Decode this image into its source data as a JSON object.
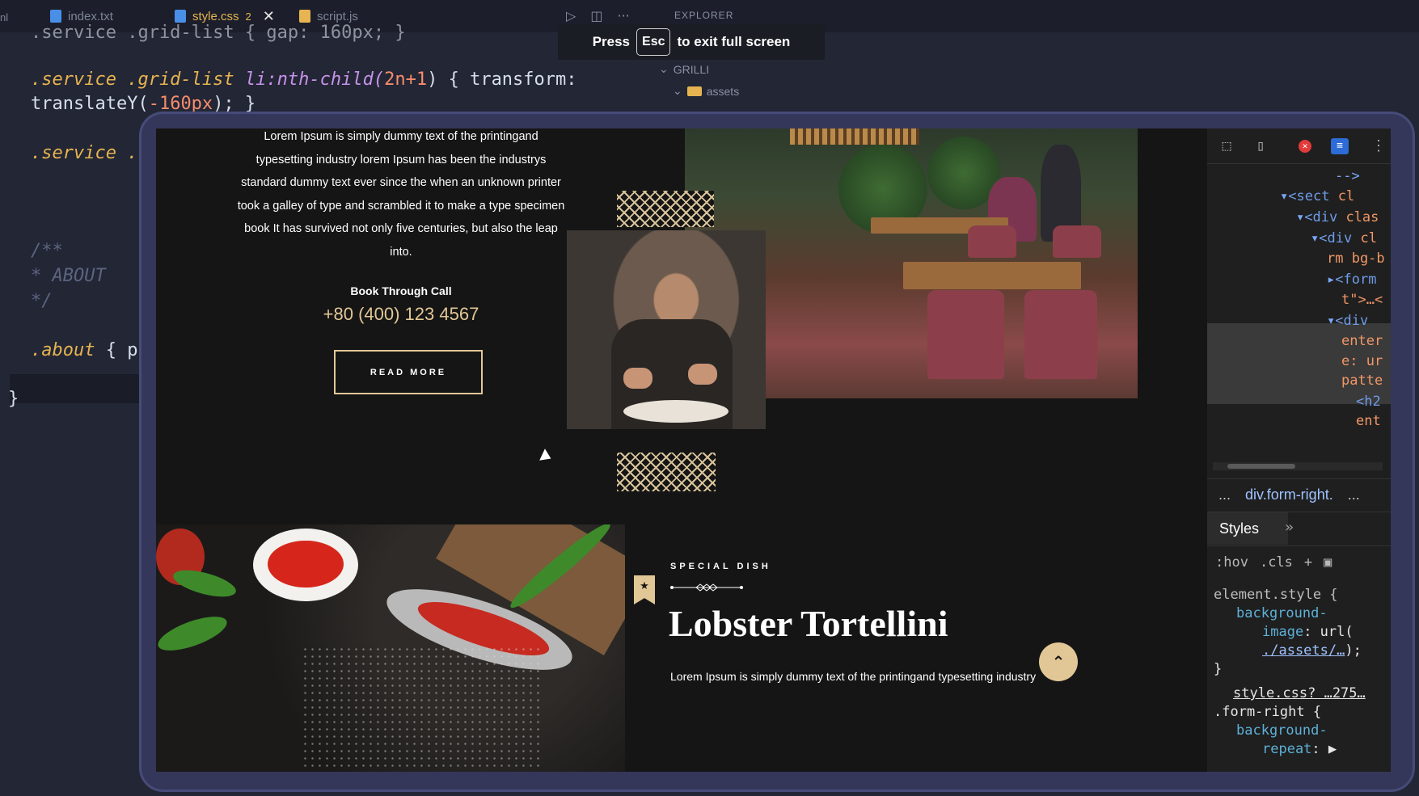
{
  "editor": {
    "edge_label": "nl",
    "tabs": [
      {
        "label": "index.txt",
        "icon": "file-text-icon",
        "icon_color": "#4a8fe7"
      },
      {
        "label": "style.css",
        "badge": "2",
        "close": "✕",
        "icon": "css-file-icon",
        "icon_color": "#4a8fe7"
      },
      {
        "label": "script.js",
        "icon": "js-file-icon",
        "icon_color": "#e6b450"
      }
    ],
    "actions": [
      "▷",
      "◫",
      "···"
    ],
    "explorer": {
      "title": "EXPLORER",
      "project": "GRILLI",
      "folder": "assets"
    },
    "code_lines": {
      "l0": ".service .grid-list { gap: 160px; }",
      "l1_sel": ".service .grid-list",
      "l1_pseudo": " li:nth-child(",
      "l1_num": "2n+1",
      "l1_rest": ") { transform:",
      "l2_fn": "translateY(",
      "l2_num": "-160px",
      "l2_rest": "); }",
      "l3": ".service .",
      "l4": "/**",
      "l5": " * ABOUT",
      "l6": " */",
      "l7_sel": ".about",
      "l7_rest": " { p",
      "l8": "}"
    }
  },
  "fullscreen_banner": {
    "press": "Press",
    "key": "Esc",
    "text": "to exit full screen"
  },
  "page": {
    "intro_text": "Lorem Ipsum is simply dummy text of the printingand typesetting industry lorem Ipsum has been the industrys standard dummy text ever since the when an unknown printer took a galley of type and scrambled it to make a type specimen book It has survived not only five centuries, but also the leap into.",
    "book_label": "Book Through Call",
    "phone": "+80 (400) 123 4567",
    "read_more": "READ MORE",
    "special_label": "SPECIAL DISH",
    "dish_title": "Lobster Tortellini",
    "dish_desc": "Lorem Ipsum is simply dummy text of the printingand typesetting industry",
    "accent": "#e2c796"
  },
  "devtools": {
    "dom_lines": {
      "d0": "-->",
      "d1_tag": "<sect",
      "d1_attr": "cl",
      "d2_tag": "<div",
      "d2_attr": "clas",
      "d3_tag": "<div",
      "d3_attr": "cl",
      "d4": "rm bg-b",
      "d5_tag": "<form",
      "d6": "t\">…<",
      "d7_tag": "<div",
      "d8": "enter",
      "d9": "e: ur",
      "d10": "patte",
      "d11_tag": "<h2",
      "d12": "ent"
    },
    "breadcrumb_ellipsis": "...",
    "breadcrumb": "div.form-right.",
    "breadcrumb_more": "...",
    "styles_tab": "Styles",
    "more_tabs": "»",
    "hov": ":hov",
    "cls": ".cls",
    "plus": "+",
    "element_style": "element.style {",
    "bg_image_prop": "background-",
    "bg_image_prop2": "image",
    "bg_image_url_prefix": ": url(",
    "bg_image_url": "./assets/…",
    "bg_image_suffix": ");",
    "close_brace": "}",
    "source_link": "style.css? …275…",
    "form_right_sel": ".form-right {",
    "bg_repeat_prop": "background-",
    "bg_repeat_prop2": "repeat",
    "bg_repeat_rest": ": ▶"
  }
}
